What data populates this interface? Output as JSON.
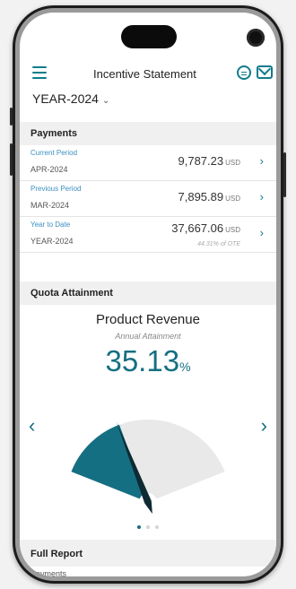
{
  "header": {
    "title": "Incentive Statement",
    "year_selector": "YEAR-2024"
  },
  "payments": {
    "heading": "Payments",
    "rows": [
      {
        "label": "Current Period",
        "date": "APR-2024",
        "amount": "9,787.23",
        "currency": "USD",
        "sub": ""
      },
      {
        "label": "Previous Period",
        "date": "MAR-2024",
        "amount": "7,895.89",
        "currency": "USD",
        "sub": ""
      },
      {
        "label": "Year to Date",
        "date": "YEAR-2024",
        "amount": "37,667.06",
        "currency": "USD",
        "sub": "44.31% of OTE"
      }
    ]
  },
  "quota": {
    "heading": "Quota Attainment",
    "card_title": "Product Revenue",
    "card_subtitle": "Annual Attainment",
    "value": "35.13",
    "value_unit": "%",
    "attainment_fraction": 0.3513,
    "carousel": {
      "pages": 3,
      "active": 1
    }
  },
  "full_report": {
    "heading": "Full Report",
    "first_item": "Payments"
  },
  "colors": {
    "accent": "#156f82",
    "gauge_track": "#e9e9e9",
    "needle": "#0e2a33",
    "link": "#3b8fbf"
  }
}
